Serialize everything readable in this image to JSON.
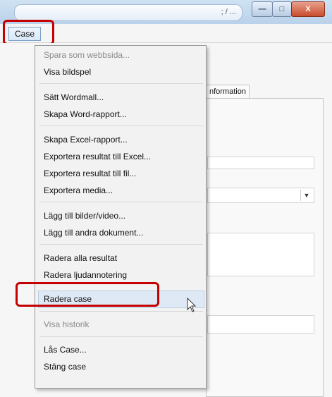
{
  "titlebar": {
    "partial_text": "; / ..."
  },
  "window_buttons": {
    "minimize": "—",
    "maximize": "□",
    "close": "X"
  },
  "menubar": {
    "case_label": "Case"
  },
  "background": {
    "tab_label": "nformation"
  },
  "menu": {
    "items": [
      {
        "label": "Spara som webbsida...",
        "enabled": false
      },
      {
        "label": "Visa bildspel",
        "enabled": true
      },
      {
        "label": "Sätt Wordmall...",
        "enabled": true
      },
      {
        "label": "Skapa Word-rapport...",
        "enabled": true
      },
      {
        "label": "Skapa Excel-rapport...",
        "enabled": true
      },
      {
        "label": "Exportera resultat till Excel...",
        "enabled": true
      },
      {
        "label": "Exportera resultat till fil...",
        "enabled": true
      },
      {
        "label": "Exportera media...",
        "enabled": true
      },
      {
        "label": "Lägg till bilder/video...",
        "enabled": true
      },
      {
        "label": "Lägg till andra dokument...",
        "enabled": true
      },
      {
        "label": "Radera alla resultat",
        "enabled": true
      },
      {
        "label": "Radera ljudannotering",
        "enabled": true
      },
      {
        "label": "Radera case",
        "enabled": true,
        "hovered": true
      },
      {
        "label": "Visa historik",
        "enabled": false
      },
      {
        "label": "Lås Case...",
        "enabled": true
      },
      {
        "label": "Stäng case",
        "enabled": true
      }
    ]
  },
  "colors": {
    "highlight_outline": "#c40000",
    "hover_background": "#dfe9f5",
    "disabled_text": "#8a8a8a"
  }
}
